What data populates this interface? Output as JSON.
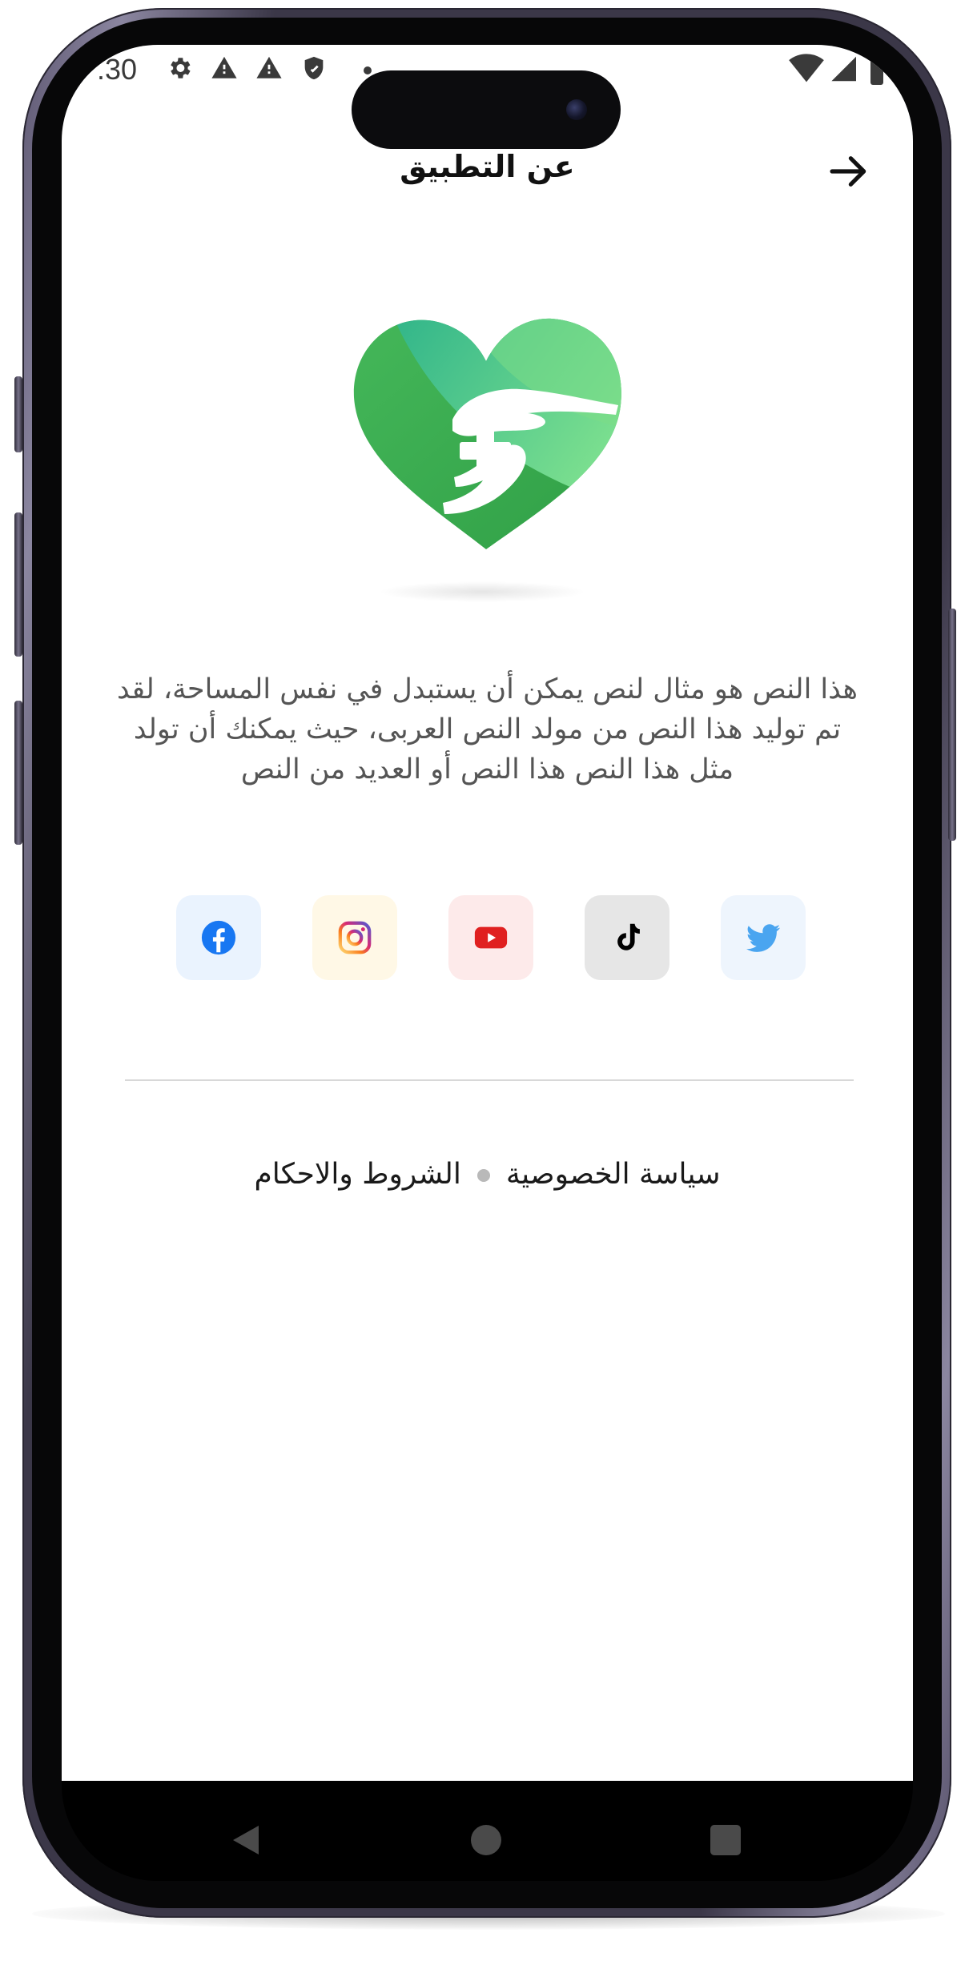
{
  "status_bar": {
    "time": ".30"
  },
  "header": {
    "title": "عن التطبيق",
    "back_icon": "arrow-right-icon"
  },
  "logo": {
    "icon": "heart-hands-medical-cross-logo",
    "colors": {
      "primary": "#3aaa4e",
      "light": "#6fd98a"
    }
  },
  "description": "هذا النص هو مثال لنص يمكن أن يستبدل في نفس المساحة، لقد تم توليد هذا النص من مولد النص العربى، حيث يمكنك أن تولد مثل هذا النص هذا النص أو العديد من النص",
  "social": [
    {
      "name": "facebook",
      "icon": "facebook-icon",
      "bg": "#eaf3fe",
      "color": "#1877f2"
    },
    {
      "name": "instagram",
      "icon": "instagram-icon",
      "bg": "#fff8e6",
      "color": "#e1306c"
    },
    {
      "name": "youtube",
      "icon": "youtube-icon",
      "bg": "#fdeaea",
      "color": "#e02020"
    },
    {
      "name": "tiktok",
      "icon": "tiktok-icon",
      "bg": "#e6e6e6",
      "color": "#000000"
    },
    {
      "name": "twitter",
      "icon": "twitter-icon",
      "bg": "#eef5fd",
      "color": "#4aa5f0"
    }
  ],
  "links": {
    "privacy": "سياسة الخصوصية",
    "terms": "الشروط والاحكام"
  },
  "nav_bar": {
    "back": "triangle-back-icon",
    "home": "circle-home-icon",
    "recents": "square-recents-icon"
  }
}
